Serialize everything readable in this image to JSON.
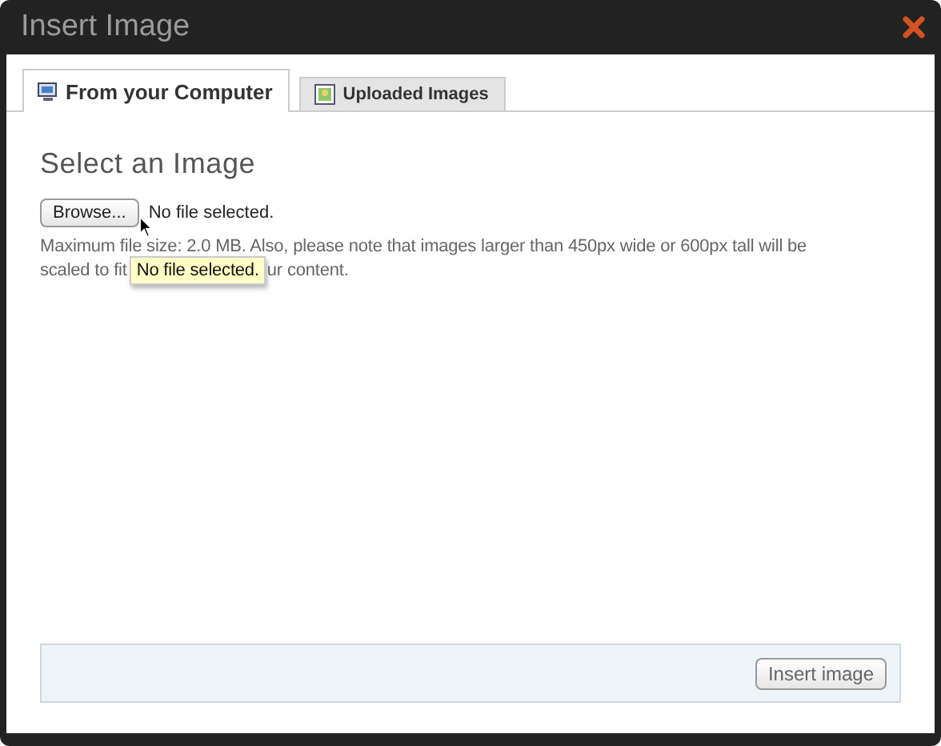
{
  "window": {
    "title": "Insert Image"
  },
  "tabs": [
    {
      "label": "From your Computer",
      "selected": true,
      "kind": "computer"
    },
    {
      "label": "Uploaded Images",
      "selected": false,
      "kind": "images"
    }
  ],
  "heading": "Select an Image",
  "browse_button": "Browse...",
  "file_status": "No file selected.",
  "help_line_1": "Maximum file size: 2.0 MB. Also, please note that images larger than 450px wide or 600px tall will be",
  "help_line_2_start": "scaled to fit",
  "help_line_2_end": "ur content.",
  "tooltip": "No file selected.",
  "insert_button": "Insert image"
}
